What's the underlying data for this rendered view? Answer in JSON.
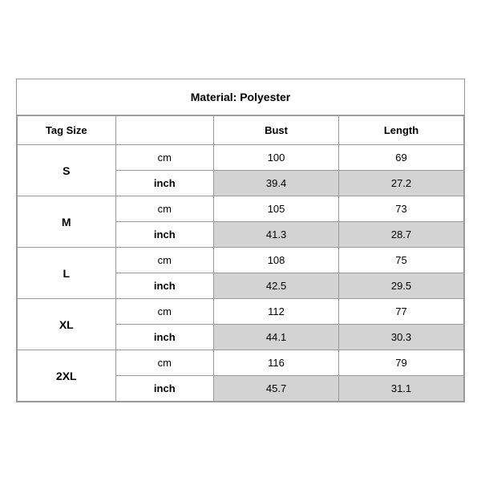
{
  "title": "Material: Polyester",
  "headers": {
    "tag_size": "Tag Size",
    "bust": "Bust",
    "length": "Length"
  },
  "rows": [
    {
      "size": "S",
      "cm": {
        "bust": "100",
        "length": "69"
      },
      "inch": {
        "bust": "39.4",
        "length": "27.2"
      }
    },
    {
      "size": "M",
      "cm": {
        "bust": "105",
        "length": "73"
      },
      "inch": {
        "bust": "41.3",
        "length": "28.7"
      }
    },
    {
      "size": "L",
      "cm": {
        "bust": "108",
        "length": "75"
      },
      "inch": {
        "bust": "42.5",
        "length": "29.5"
      }
    },
    {
      "size": "XL",
      "cm": {
        "bust": "112",
        "length": "77"
      },
      "inch": {
        "bust": "44.1",
        "length": "30.3"
      }
    },
    {
      "size": "2XL",
      "cm": {
        "bust": "116",
        "length": "79"
      },
      "inch": {
        "bust": "45.7",
        "length": "31.1"
      }
    }
  ],
  "units": {
    "cm": "cm",
    "inch": "inch"
  }
}
